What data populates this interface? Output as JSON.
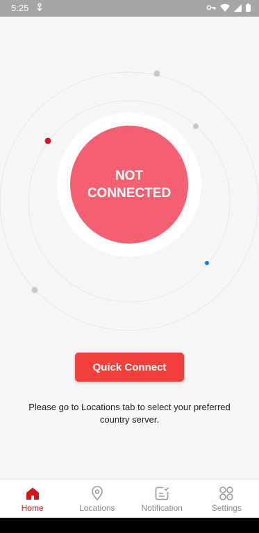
{
  "status_bar": {
    "time": "5:25"
  },
  "connection": {
    "line1": "NOT",
    "line2": "CONNECTED"
  },
  "quick_connect_label": "Quick Connect",
  "hint_text": "Please go to Locations tab to select your preferred country server.",
  "nav": {
    "items": [
      {
        "label": "Home",
        "icon": "home-icon",
        "active": true
      },
      {
        "label": "Locations",
        "icon": "location-pin-icon",
        "active": false
      },
      {
        "label": "Notification",
        "icon": "notification-icon",
        "active": false
      },
      {
        "label": "Settings",
        "icon": "settings-grid-icon",
        "active": false
      }
    ]
  },
  "colors": {
    "accent": "#d4151c",
    "disconnected": "#f26072",
    "button": "#f2403b",
    "dot_red": "#d4151c",
    "dot_blue": "#1a73e8",
    "dot_gray": "#c8c8c8"
  }
}
